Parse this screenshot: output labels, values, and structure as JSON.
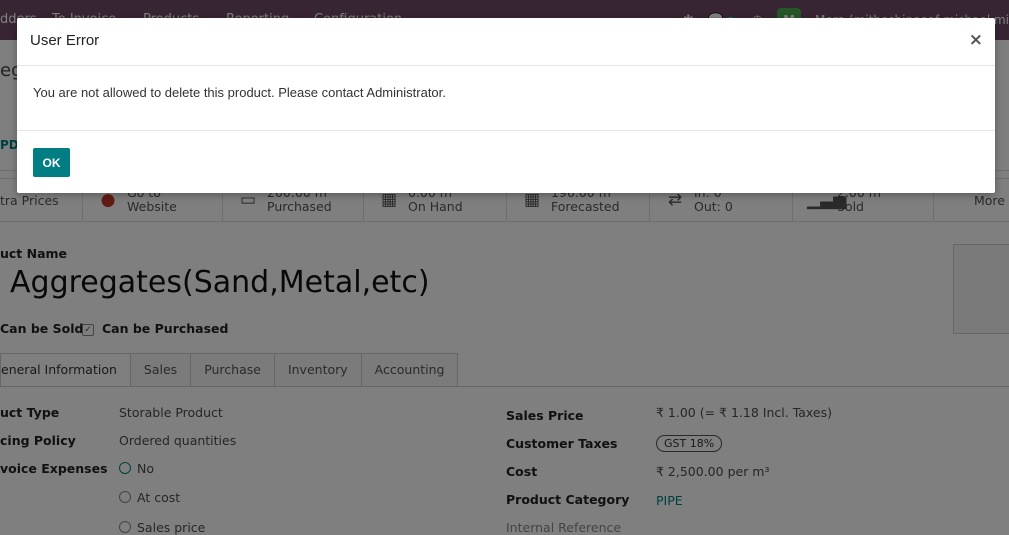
{
  "topbar": {
    "menu": [
      "dders",
      "To Invoice",
      "Products",
      "Reporting",
      "Configuration"
    ],
    "chat_count": "3",
    "avatar_letter": "M",
    "user": "Mera (mitheshinoeaf mishael.mi"
  },
  "control": {
    "breadcrumb": "ega",
    "update_btn": "PDA"
  },
  "stats": [
    {
      "icon": "globe-icon",
      "l1": "Go to",
      "l2": "Website"
    },
    {
      "icon": "card-icon",
      "l1": "200.00 m",
      "l2": "Purchased"
    },
    {
      "icon": "cubes-icon",
      "l1": "0.00 m",
      "l2": "On Hand"
    },
    {
      "icon": "cubes-icon",
      "l1": "196.00 m",
      "l2": "Forecasted"
    },
    {
      "icon": "exchange-icon",
      "l1": "In:  0",
      "l2": "Out:  0"
    },
    {
      "icon": "bars-icon",
      "l1": "2.00 m",
      "l2": "Sold"
    }
  ],
  "stat_first": "tra Prices",
  "stat_more": "More",
  "product": {
    "name_label": "uct Name",
    "name": "Aggregates(Sand,Metal,etc)",
    "can_be_sold": "Can be Sold",
    "can_be_purchased": "Can be Purchased"
  },
  "tabs": [
    "eneral Information",
    "Sales",
    "Purchase",
    "Inventory",
    "Accounting"
  ],
  "left_fields": {
    "type_label": "uct Type",
    "type_value": "Storable Product",
    "policy_label": "cing Policy",
    "policy_value": "Ordered quantities",
    "expenses_label": "voice Expenses",
    "opt_no": "No",
    "opt_cost": "At cost",
    "opt_sales": "Sales price"
  },
  "right_fields": {
    "sales_price_label": "Sales Price",
    "sales_price_value": "₹ 1.00  (= ₹ 1.18 Incl. Taxes)",
    "taxes_label": "Customer Taxes",
    "taxes_value": "GST 18%",
    "cost_label": "Cost",
    "cost_value": "₹ 2,500.00  per m³",
    "category_label": "Product Category",
    "category_value": "PIPE",
    "ref_label": "Internal Reference"
  },
  "dialog": {
    "title": "User Error",
    "close": "×",
    "message": "You are not allowed to delete this product. Please contact Administrator.",
    "ok": "OK"
  }
}
